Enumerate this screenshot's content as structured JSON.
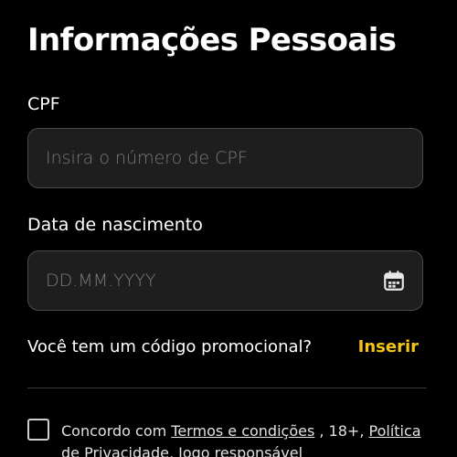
{
  "page": {
    "title": "Informações Pessoais"
  },
  "cpf": {
    "label": "CPF",
    "placeholder": "Insira o número de CPF",
    "value": ""
  },
  "birthdate": {
    "label": "Data de nascimento",
    "placeholder": "DD.MM.YYYY",
    "value": "",
    "icon": "calendar-icon"
  },
  "promo": {
    "question": "Você tem um código promocional?",
    "link_label": "Inserir"
  },
  "terms": {
    "checked": false,
    "prefix": "Concordo com ",
    "terms_link": "Termos e condições",
    "separator_1": " , 18+, ",
    "privacy_link": "Política de Privacidade",
    "separator_2": ", ",
    "responsible_link": "Jogo responsável"
  },
  "colors": {
    "background": "#000000",
    "input_background": "#1e1e1e",
    "input_border": "#4a4a4a",
    "accent": "#f5c518",
    "placeholder": "#7a7a7a"
  }
}
